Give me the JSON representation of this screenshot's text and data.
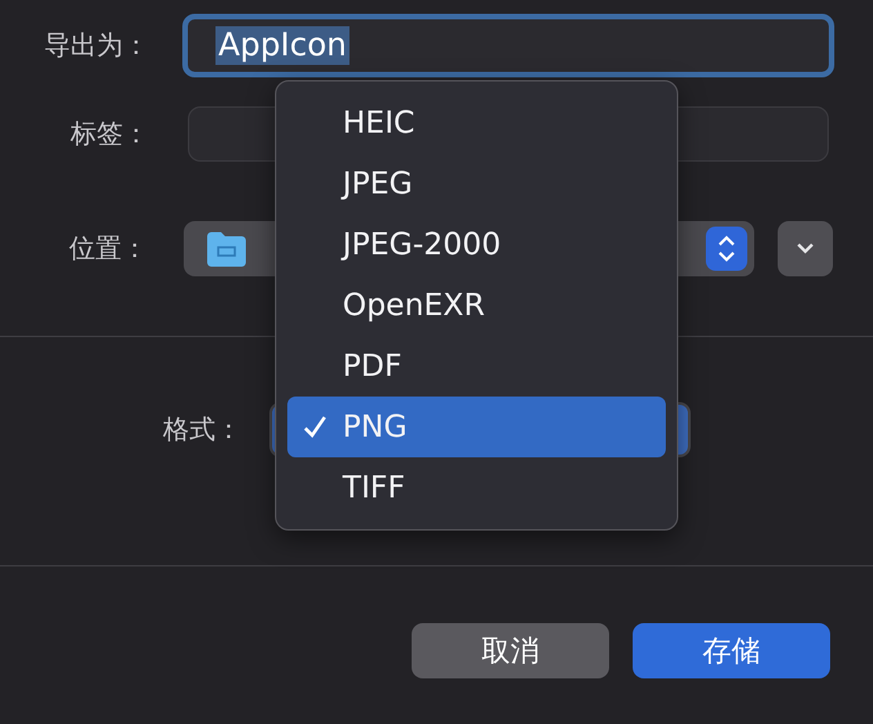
{
  "export_as": {
    "label": "导出为：",
    "value": "AppIcon",
    "value_selected": true,
    "focused": true
  },
  "tags": {
    "label": "标签："
  },
  "location": {
    "label": "位置："
  },
  "format": {
    "label": "格式："
  },
  "format_menu": {
    "items": [
      {
        "label": "HEIC",
        "selected": false
      },
      {
        "label": "JPEG",
        "selected": false
      },
      {
        "label": "JPEG-2000",
        "selected": false
      },
      {
        "label": "OpenEXR",
        "selected": false
      },
      {
        "label": "PDF",
        "selected": false
      },
      {
        "label": "PNG",
        "selected": true
      },
      {
        "label": "TIFF",
        "selected": false
      }
    ]
  },
  "buttons": [
    {
      "label": "取消",
      "kind": "secondary"
    },
    {
      "label": "存储",
      "kind": "primary"
    }
  ]
}
